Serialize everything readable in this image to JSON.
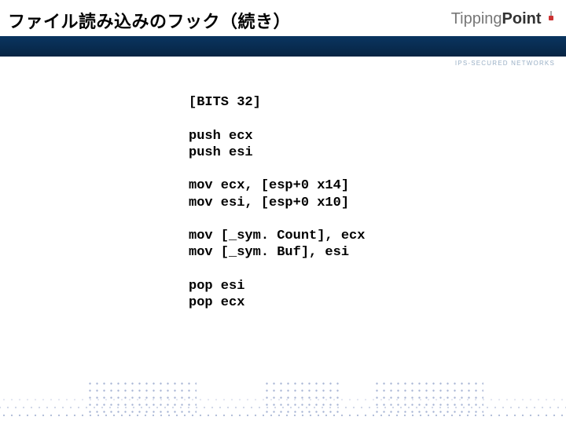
{
  "header": {
    "title": "ファイル読み込みのフック（続き）",
    "logo_left": "Tipping",
    "logo_right": "Point",
    "tagline": "IPS-SECURED NETWORKS"
  },
  "code": {
    "lines": [
      "[BITS 32]",
      "",
      "push ecx",
      "push esi",
      "",
      "mov ecx, [esp+0 x14]",
      "mov esi, [esp+0 x10]",
      "",
      "mov [_sym. Count], ecx",
      "mov [_sym. Buf], esi",
      "",
      "pop esi",
      "pop ecx"
    ]
  }
}
